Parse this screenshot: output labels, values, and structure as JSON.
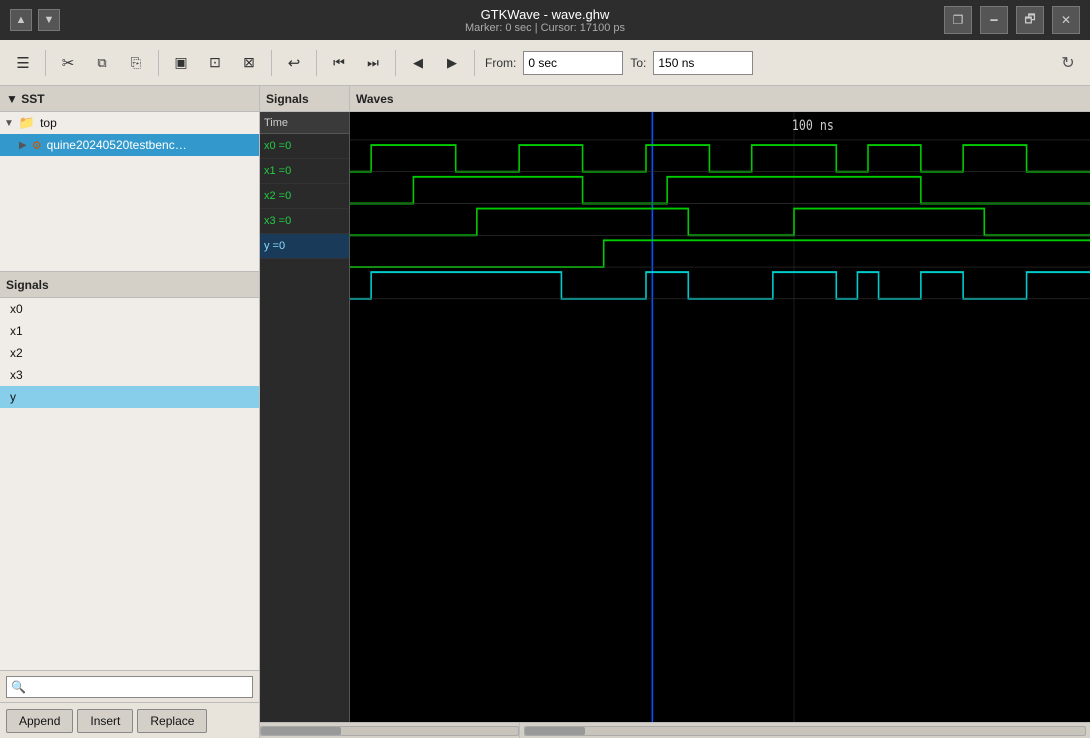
{
  "titlebar": {
    "title": "GTKWave - wave.ghw",
    "subtitle": "Marker: 0 sec  |  Cursor: 17100 ps",
    "up_arrow": "▲",
    "down_arrow": "▼",
    "minimize": "🗕",
    "restore": "🗗",
    "close": "✕",
    "restore_icon": "❐"
  },
  "toolbar": {
    "from_label": "From:",
    "from_value": "0 sec",
    "to_label": "To:",
    "to_value": "150 ns",
    "buttons": [
      {
        "name": "menu-icon",
        "symbol": "☰",
        "label": "Menu"
      },
      {
        "name": "cut-icon",
        "symbol": "✂",
        "label": "Cut"
      },
      {
        "name": "copy-icon",
        "symbol": "⧉",
        "label": "Copy"
      },
      {
        "name": "paste-icon",
        "symbol": "⎘",
        "label": "Paste"
      },
      {
        "name": "select-all-icon",
        "symbol": "▣",
        "label": "Select All"
      },
      {
        "name": "zoom-fit-icon",
        "symbol": "⊡",
        "label": "Zoom Fit"
      },
      {
        "name": "zoom-area-icon",
        "symbol": "⊠",
        "label": "Zoom Area"
      },
      {
        "name": "undo-icon",
        "symbol": "↩",
        "label": "Undo"
      },
      {
        "name": "first-icon",
        "symbol": "⏮",
        "label": "First"
      },
      {
        "name": "last-icon",
        "symbol": "⏭",
        "label": "Last"
      },
      {
        "name": "prev-icon",
        "symbol": "◀",
        "label": "Prev"
      },
      {
        "name": "next-icon",
        "symbol": "▶",
        "label": "Next"
      }
    ]
  },
  "sst": {
    "header": "▼ SST",
    "tree": [
      {
        "label": "top",
        "level": 0,
        "expanded": true,
        "type": "module",
        "id": "top-node"
      },
      {
        "label": "quine20240520testbenc…",
        "level": 1,
        "type": "instance",
        "selected": true,
        "id": "quine-node"
      }
    ]
  },
  "signals_panel": {
    "header": "Signals",
    "items": [
      {
        "label": "x0",
        "selected": false
      },
      {
        "label": "x1",
        "selected": false
      },
      {
        "label": "x2",
        "selected": false
      },
      {
        "label": "x3",
        "selected": false
      },
      {
        "label": "y",
        "selected": true
      }
    ]
  },
  "search": {
    "placeholder": "",
    "icon": "🔍"
  },
  "buttons": {
    "append": "Append",
    "insert": "Insert",
    "replace": "Replace"
  },
  "waves": {
    "col_signals": "Signals",
    "col_waves": "Waves",
    "time_label": "Time",
    "time_marker": "100 ns",
    "rows": [
      {
        "name": "x0 =0",
        "selected": false,
        "color": "green"
      },
      {
        "name": "x1 =0",
        "selected": false,
        "color": "green"
      },
      {
        "name": "x2 =0",
        "selected": false,
        "color": "green"
      },
      {
        "name": "x3 =0",
        "selected": false,
        "color": "green"
      },
      {
        "name": "y =0",
        "selected": true,
        "color": "cyan"
      }
    ]
  },
  "colors": {
    "wave_green": "#00cc00",
    "wave_cyan": "#00cccc",
    "wave_blue": "#0044ff",
    "cursor_blue": "#0066ff",
    "bg_dark": "#000000",
    "bg_light": "#e8e4dc",
    "selected_blue": "#3399cc"
  }
}
